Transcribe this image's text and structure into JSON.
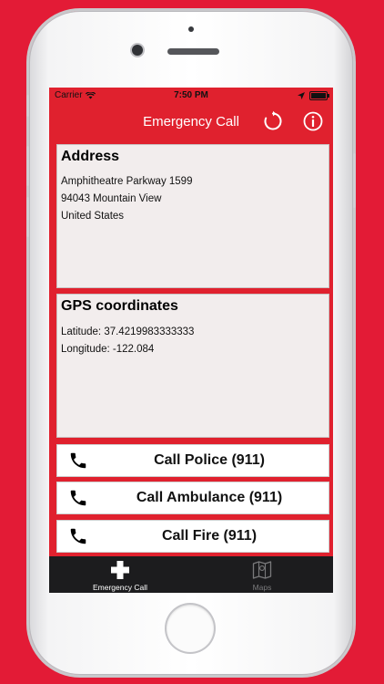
{
  "status_bar": {
    "carrier": "Carrier",
    "time": "7:50 PM"
  },
  "nav": {
    "title": "Emergency Call",
    "refresh_icon": "refresh-icon",
    "info_icon": "info-icon"
  },
  "address": {
    "heading": "Address",
    "lines": [
      "Amphitheatre Parkway 1599",
      "94043 Mountain View",
      "United States"
    ]
  },
  "gps": {
    "heading": "GPS coordinates",
    "latitude": "Latitude: 37.4219983333333",
    "longitude": "Longitude: -122.084"
  },
  "calls": [
    {
      "label": "Call Police (911)",
      "icon": "phone-icon"
    },
    {
      "label": "Call Ambulance (911)",
      "icon": "phone-icon"
    },
    {
      "label": "Call Fire (911)",
      "icon": "phone-icon"
    }
  ],
  "tabs": [
    {
      "label": "Emergency Call",
      "icon": "plus-icon",
      "active": true
    },
    {
      "label": "Maps",
      "icon": "map-icon",
      "active": false
    }
  ],
  "colors": {
    "brand_red": "#e0212e",
    "card_bg": "#f2eded",
    "tabbar_bg": "#1c1c1e"
  }
}
